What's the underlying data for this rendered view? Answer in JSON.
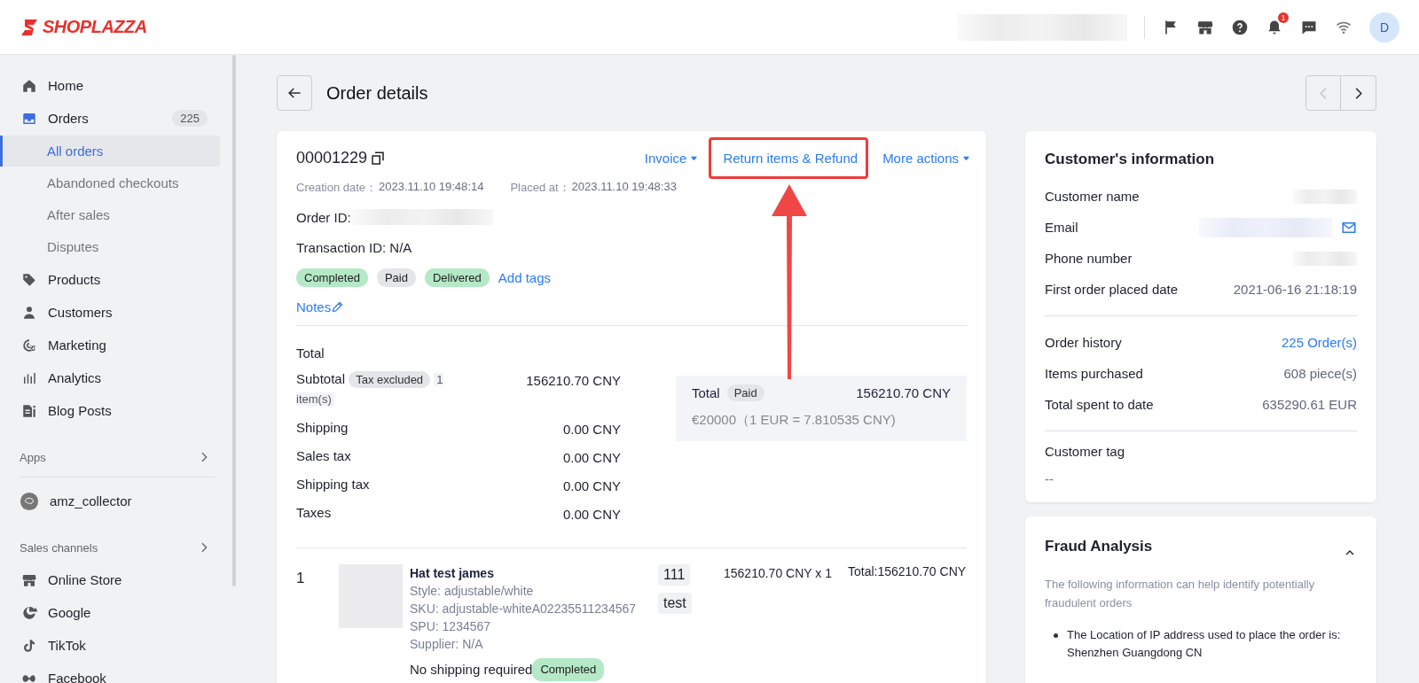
{
  "header": {
    "logo": "SHOPLAZZA",
    "notification_count": "1",
    "avatar_initial": "D"
  },
  "sidebar": {
    "items": [
      {
        "kind": "nav",
        "label": "Home"
      },
      {
        "kind": "nav",
        "label": "Orders",
        "count": "225",
        "expanded": true,
        "children": [
          {
            "label": "All orders",
            "selected": true
          },
          {
            "label": "Abandoned checkouts",
            "selected": false
          },
          {
            "label": "After sales",
            "selected": false
          },
          {
            "label": "Disputes",
            "selected": false
          }
        ]
      },
      {
        "kind": "nav",
        "label": "Products"
      },
      {
        "kind": "nav",
        "label": "Customers"
      },
      {
        "kind": "nav",
        "label": "Marketing"
      },
      {
        "kind": "nav",
        "label": "Analytics"
      },
      {
        "kind": "nav",
        "label": "Blog Posts"
      },
      {
        "kind": "section",
        "label": "Apps"
      },
      {
        "kind": "app",
        "label": "amz_collector"
      },
      {
        "kind": "section",
        "label": "Sales channels"
      },
      {
        "kind": "nav",
        "label": "Online Store"
      },
      {
        "kind": "nav",
        "label": "Google"
      },
      {
        "kind": "nav",
        "label": "TikTok"
      },
      {
        "kind": "nav",
        "label": "Facebook"
      }
    ]
  },
  "page": {
    "title": "Order details",
    "pager": {
      "previous_disabled": true,
      "next_disabled": false
    }
  },
  "order": {
    "number": "00001229",
    "actions": [
      {
        "kind": "dropdown",
        "label": "Invoice"
      },
      {
        "kind": "link",
        "label": "Return items & Refund"
      },
      {
        "kind": "dropdown",
        "label": "More actions"
      }
    ],
    "dates": [
      {
        "label": "Creation date：",
        "value": "2023.11.10 19:48:14"
      },
      {
        "label": "Placed at：",
        "value": "2023.11.10 19:48:33"
      }
    ],
    "order_id_label": "Order ID:",
    "transaction_id": "Transaction ID: N/A",
    "tags": [
      {
        "label": "Completed",
        "color": "#b4e8c6"
      },
      {
        "label": "Paid",
        "color": "#e4e5e8"
      },
      {
        "label": "Delivered",
        "color": "#b4e8c6"
      }
    ],
    "add_tags": "Add tags",
    "notes": "Notes"
  },
  "totals": {
    "heading": "Total",
    "rows": [
      {
        "label": "Subtotal",
        "badge": "Tax excluded",
        "note": "1 item(s)",
        "value": "156210.70 CNY"
      },
      {
        "label": "Shipping",
        "value": "0.00 CNY"
      },
      {
        "label": "Sales tax",
        "value": "0.00 CNY"
      },
      {
        "label": "Shipping tax",
        "value": "0.00 CNY"
      },
      {
        "label": "Taxes",
        "value": "0.00 CNY"
      }
    ]
  },
  "summary": {
    "label": "Total",
    "badge": "Paid",
    "amount": "156210.70 CNY",
    "conversion": "€20000（1 EUR = 7.810535 CNY)"
  },
  "line_items": [
    {
      "index": "1",
      "name": "Hat test james",
      "details": [
        "Style: adjustable/white",
        "SKU: adjustable-whiteA02235511234567",
        "SPU: 1234567",
        "Supplier: N/A"
      ],
      "chips": [
        "111",
        "test"
      ],
      "price": "156210.70 CNY x 1",
      "total": "Total:156210.70 CNY",
      "shipping": "No shipping required",
      "status": "Completed"
    }
  ],
  "customer": {
    "title": "Customer's information",
    "rows": [
      {
        "kind": "redacted",
        "label": "Customer name"
      },
      {
        "kind": "email",
        "label": "Email"
      },
      {
        "kind": "redacted",
        "label": "Phone number"
      },
      {
        "kind": "text",
        "label": "First order placed date",
        "value": "2021-06-16 21:18:19"
      }
    ],
    "stats": [
      {
        "kind": "link",
        "label": "Order history",
        "value": "225 Order(s)"
      },
      {
        "kind": "text",
        "label": "Items purchased",
        "value": "608 piece(s)"
      },
      {
        "kind": "text",
        "label": "Total spent to date",
        "value": "635290.61 EUR"
      }
    ],
    "tag_label": "Customer tag",
    "tag_value": "--"
  },
  "fraud": {
    "title": "Fraud Analysis",
    "expanded": true,
    "description": "The following information can help identify potentially fraudulent orders",
    "points": [
      "The Location of IP address used to place the order is: Shenzhen Guangdong CN"
    ]
  }
}
